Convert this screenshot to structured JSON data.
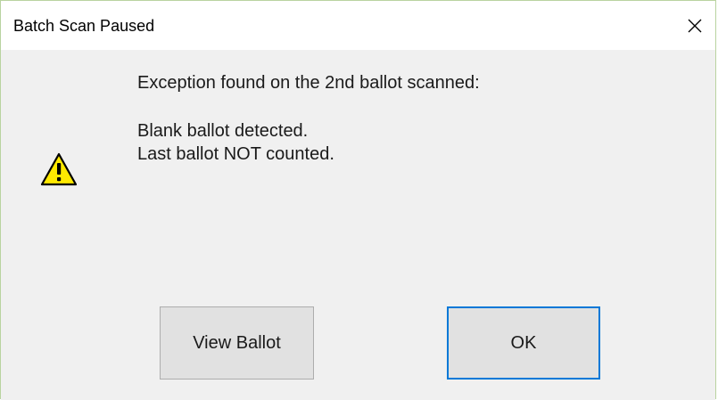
{
  "window": {
    "title": "Batch Scan Paused",
    "close_glyph": "✕"
  },
  "message": {
    "line1": "Exception found on the 2nd ballot scanned:",
    "line2": "Blank ballot detected.",
    "line3": "Last ballot NOT counted."
  },
  "icon": {
    "name": "warning-icon",
    "fill": "#ffe900",
    "stroke": "#000000"
  },
  "buttons": {
    "view_ballot": "View Ballot",
    "ok": "OK"
  },
  "colors": {
    "default_button_border": "#0078d7",
    "dialog_background": "#f0f0f0"
  }
}
